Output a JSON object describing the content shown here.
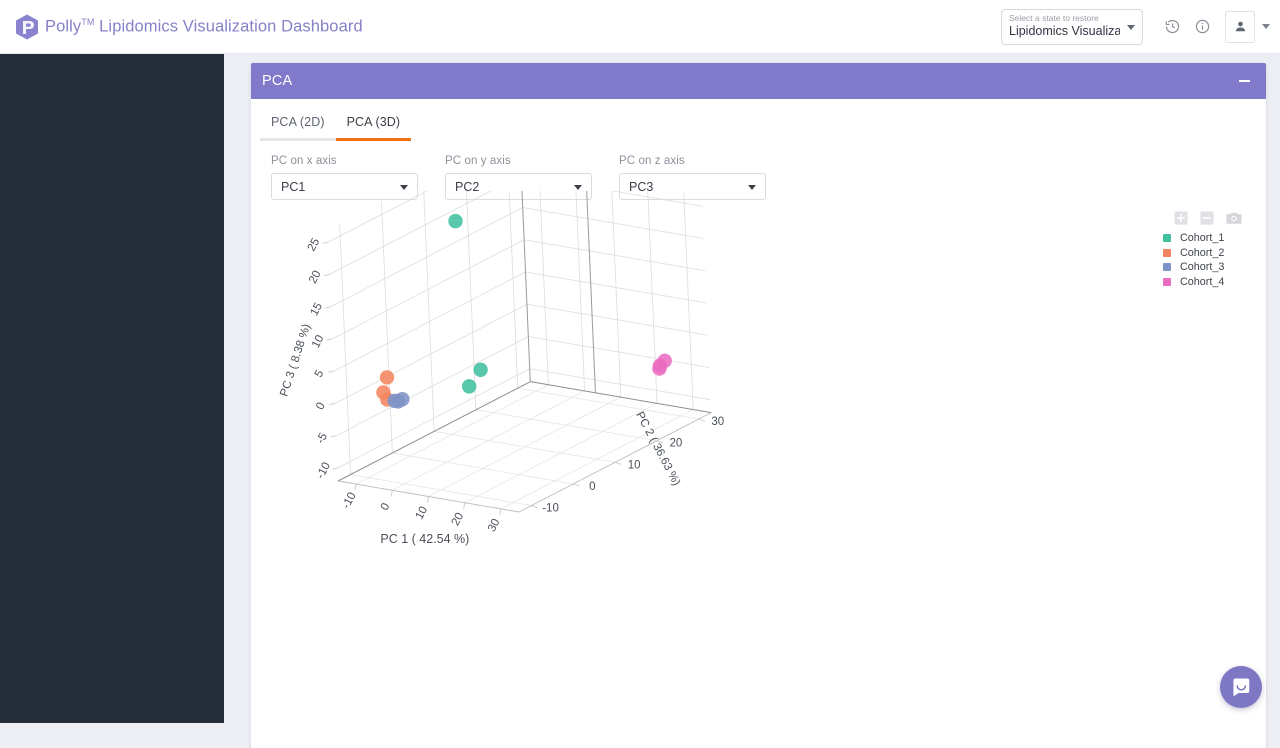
{
  "header": {
    "brand_polly": "Polly",
    "brand_tm": "TM",
    "brand_rest": "Lipidomics Visualization Dashboard",
    "logo_icon": "polly-hexagon-logo",
    "state_select": {
      "label": "Select a state to restore",
      "value": "Lipidomics Visualiza...",
      "caret_icon": "chevron-down-icon"
    },
    "history_icon": "history-restore-icon",
    "info_icon": "info-circle-icon",
    "account_icon": "person-icon",
    "account_caret_icon": "chevron-down-icon"
  },
  "panel": {
    "title": "PCA",
    "minimize_icon": "minimize-icon",
    "tabs": [
      {
        "label": "PCA (2D)",
        "active": false
      },
      {
        "label": "PCA (3D)",
        "active": true
      }
    ],
    "active_tab_color": "#f2700f",
    "header_color": "#8179c9",
    "controls": [
      {
        "label": "PC on x axis",
        "value": "PC1",
        "caret_icon": "chevron-down-icon"
      },
      {
        "label": "PC on y axis",
        "value": "PC2",
        "caret_icon": "chevron-down-icon"
      },
      {
        "label": "PC on z axis",
        "value": "PC3",
        "caret_icon": "chevron-down-icon"
      }
    ]
  },
  "plot_toolbar": [
    {
      "icon": "zoom-in-icon"
    },
    {
      "icon": "zoom-out-icon"
    },
    {
      "icon": "camera-download-icon"
    }
  ],
  "chat": {
    "icon": "chat-bubble-icon",
    "color": "#7d77c4"
  },
  "chart_data": {
    "type": "scatter",
    "dimensions": "3d",
    "title": "",
    "xlabel": "PC 1 ( 42.54 %)",
    "ylabel": "PC 2 ( 36.63 %)",
    "zlabel": "PC 3 ( 8.38 %)",
    "xticks": [
      "-10",
      "0",
      "10",
      "20",
      "30"
    ],
    "yticks": [
      "30",
      "20",
      "10",
      "0",
      "-10"
    ],
    "zticks": [
      "25",
      "20",
      "15",
      "10",
      "5",
      "0",
      "-5",
      "-10"
    ],
    "xlim": [
      -15,
      35
    ],
    "ylim": [
      -13,
      33
    ],
    "zlim": [
      -12,
      27
    ],
    "grid": true,
    "legend_position": "top-right",
    "series": [
      {
        "name": "Cohort_1",
        "color": "#41c0a0",
        "points": [
          {
            "x": 3,
            "y": 2,
            "z": 25
          },
          {
            "x": 7,
            "y": 3,
            "z": 2
          },
          {
            "x": 6,
            "y": 1,
            "z": 0
          }
        ]
      },
      {
        "name": "Cohort_2",
        "color": "#f4845f",
        "points": [
          {
            "x": -12,
            "y": -3,
            "z": 1
          },
          {
            "x": -12,
            "y": -4,
            "z": -1
          },
          {
            "x": -11,
            "y": -4,
            "z": -2
          }
        ]
      },
      {
        "name": "Cohort_3",
        "color": "#7e93c6",
        "points": [
          {
            "x": -9,
            "y": -4,
            "z": -2
          },
          {
            "x": -8,
            "y": -4,
            "z": -2
          },
          {
            "x": -8,
            "y": -3,
            "z": -2
          }
        ]
      },
      {
        "name": "Cohort_4",
        "color": "#ea6cc0",
        "points": [
          {
            "x": 31,
            "y": 26,
            "z": -2
          },
          {
            "x": 32,
            "y": 24,
            "z": -2
          },
          {
            "x": 33,
            "y": 23,
            "z": -2
          }
        ]
      }
    ]
  }
}
